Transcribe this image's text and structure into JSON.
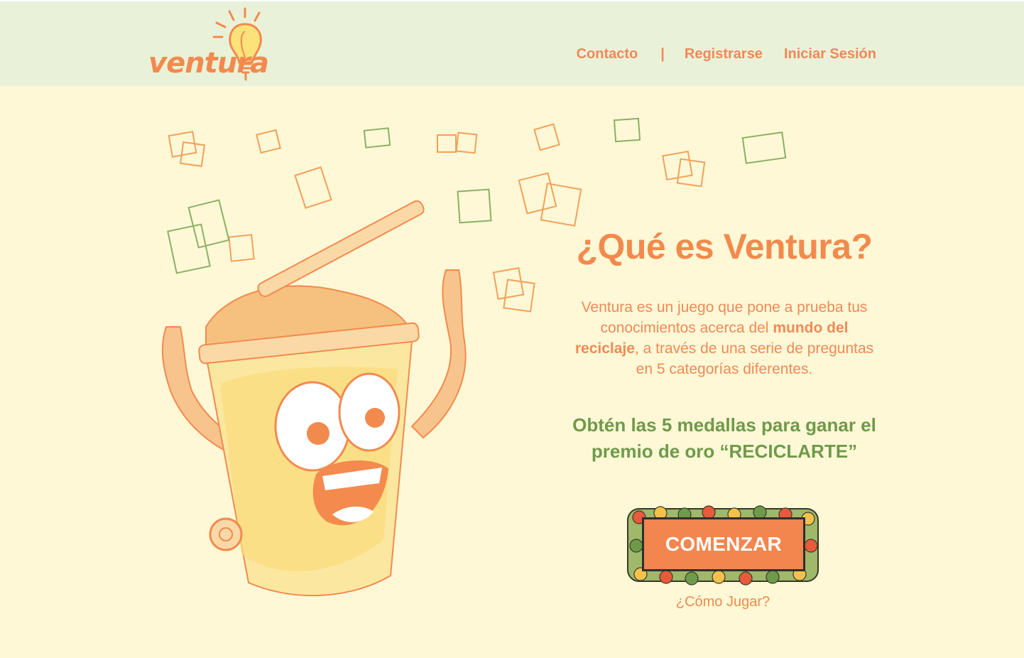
{
  "header": {
    "logo_text": "ventura",
    "nav": {
      "contact": "Contacto",
      "separator": "|",
      "register": "Registrarse",
      "login": "Iniciar Sesión"
    }
  },
  "hero": {
    "title": "¿Qué es Ventura?",
    "description": {
      "part1": "Ventura es un juego que pone a prueba tus conocimientos acerca del ",
      "bold": "mundo del reciclaje",
      "part2": ", a través de una serie de preguntas en 5 categorías diferentes."
    },
    "goal": {
      "part1": "Obtén las 5 medallas para ganar el premio de oro “",
      "bold": "RECICLARTE",
      "part2": "”"
    },
    "start_button": "COMENZAR",
    "how_to_play": "¿Cómo Jugar?"
  },
  "colors": {
    "header_bg": "#e9f2d8",
    "page_bg": "#fef8d6",
    "accent_orange": "#f28a4e",
    "accent_green": "#6f9a4a"
  }
}
